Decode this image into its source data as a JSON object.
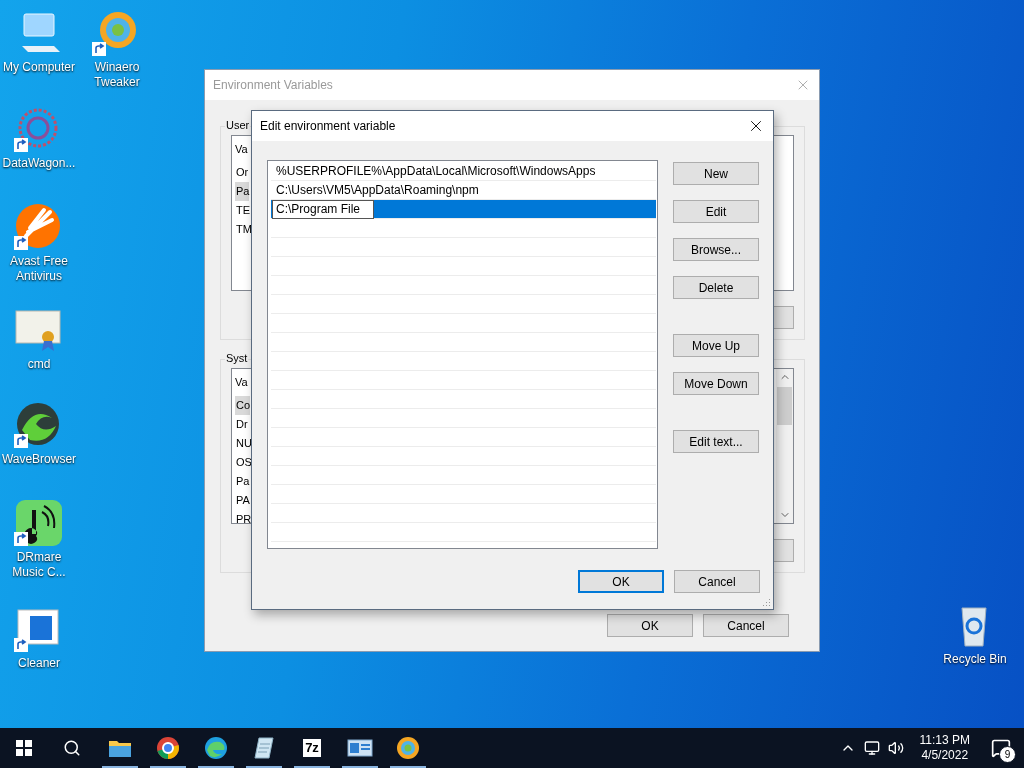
{
  "desktop_icons": [
    {
      "label": "My Computer",
      "kind": "computer",
      "shortcut": false
    },
    {
      "label": "Winaero Tweaker",
      "kind": "winaero",
      "shortcut": true
    },
    {
      "label": "DataWagon...",
      "kind": "datawagon",
      "shortcut": true
    },
    {
      "label": "Avast Free Antivirus",
      "kind": "avast",
      "shortcut": true
    },
    {
      "label": "cmd",
      "kind": "certificate",
      "shortcut": false
    },
    {
      "label": "WaveBrowser",
      "kind": "wave",
      "shortcut": true
    },
    {
      "label": "DRmare Music C...",
      "kind": "music",
      "shortcut": true
    },
    {
      "label": "Cleaner",
      "kind": "cleaner",
      "shortcut": true
    },
    {
      "label": "Recycle Bin",
      "kind": "recycle",
      "shortcut": false
    }
  ],
  "back_window": {
    "title": "Environment Variables",
    "user_group": {
      "label": "User",
      "header": "Va",
      "rows": [
        {
          "text": "Or",
          "selected": false
        },
        {
          "text": "Pa",
          "selected": true
        },
        {
          "text": "TE",
          "selected": false
        },
        {
          "text": "TM",
          "selected": false
        }
      ]
    },
    "system_group": {
      "label": "Syst",
      "header": "Va",
      "rows": [
        {
          "text": "Co",
          "selected": true
        },
        {
          "text": "Dr",
          "selected": false
        },
        {
          "text": "NU",
          "selected": false
        },
        {
          "text": "OS",
          "selected": false
        },
        {
          "text": "Pa",
          "selected": false
        },
        {
          "text": "PA",
          "selected": false
        },
        {
          "text": "PR",
          "selected": false
        }
      ]
    },
    "buttons": [
      "OK",
      "Cancel"
    ]
  },
  "dialog": {
    "title": "Edit environment variable",
    "entries": [
      {
        "text": "%USERPROFILE%\\AppData\\Local\\Microsoft\\WindowsApps",
        "selected": false,
        "editing": false
      },
      {
        "text": "C:\\Users\\VM5\\AppData\\Roaming\\npm",
        "selected": false,
        "editing": false
      },
      {
        "text": "C:\\Program File",
        "selected": true,
        "editing": true
      }
    ],
    "button_groups": [
      [
        "New",
        "Edit",
        "Browse...",
        "Delete"
      ],
      [
        "Move Up",
        "Move Down"
      ],
      [
        "Edit text..."
      ]
    ],
    "footer": [
      {
        "label": "OK",
        "default": true
      },
      {
        "label": "Cancel",
        "default": false
      }
    ]
  },
  "taskbar": {
    "apps": [
      {
        "kind": "explorer",
        "running": true
      },
      {
        "kind": "chrome",
        "running": true
      },
      {
        "kind": "edge",
        "running": true
      },
      {
        "kind": "notepad",
        "running": true
      },
      {
        "kind": "archiver",
        "running": true,
        "label": "7z"
      },
      {
        "kind": "control",
        "running": true
      },
      {
        "kind": "winaero",
        "running": true
      }
    ],
    "time": "11:13 PM",
    "date": "4/5/2022",
    "notifications": "9"
  }
}
